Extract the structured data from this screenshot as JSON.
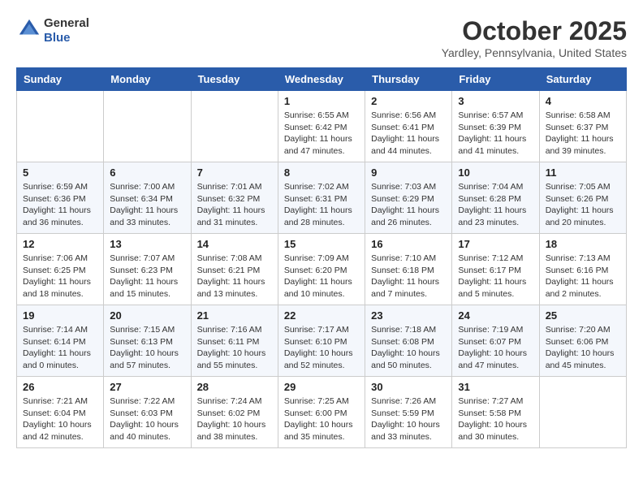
{
  "header": {
    "logo_line1": "General",
    "logo_line2": "Blue",
    "month": "October 2025",
    "location": "Yardley, Pennsylvania, United States"
  },
  "weekdays": [
    "Sunday",
    "Monday",
    "Tuesday",
    "Wednesday",
    "Thursday",
    "Friday",
    "Saturday"
  ],
  "weeks": [
    [
      {
        "day": "",
        "info": ""
      },
      {
        "day": "",
        "info": ""
      },
      {
        "day": "",
        "info": ""
      },
      {
        "day": "1",
        "info": "Sunrise: 6:55 AM\nSunset: 6:42 PM\nDaylight: 11 hours and 47 minutes."
      },
      {
        "day": "2",
        "info": "Sunrise: 6:56 AM\nSunset: 6:41 PM\nDaylight: 11 hours and 44 minutes."
      },
      {
        "day": "3",
        "info": "Sunrise: 6:57 AM\nSunset: 6:39 PM\nDaylight: 11 hours and 41 minutes."
      },
      {
        "day": "4",
        "info": "Sunrise: 6:58 AM\nSunset: 6:37 PM\nDaylight: 11 hours and 39 minutes."
      }
    ],
    [
      {
        "day": "5",
        "info": "Sunrise: 6:59 AM\nSunset: 6:36 PM\nDaylight: 11 hours and 36 minutes."
      },
      {
        "day": "6",
        "info": "Sunrise: 7:00 AM\nSunset: 6:34 PM\nDaylight: 11 hours and 33 minutes."
      },
      {
        "day": "7",
        "info": "Sunrise: 7:01 AM\nSunset: 6:32 PM\nDaylight: 11 hours and 31 minutes."
      },
      {
        "day": "8",
        "info": "Sunrise: 7:02 AM\nSunset: 6:31 PM\nDaylight: 11 hours and 28 minutes."
      },
      {
        "day": "9",
        "info": "Sunrise: 7:03 AM\nSunset: 6:29 PM\nDaylight: 11 hours and 26 minutes."
      },
      {
        "day": "10",
        "info": "Sunrise: 7:04 AM\nSunset: 6:28 PM\nDaylight: 11 hours and 23 minutes."
      },
      {
        "day": "11",
        "info": "Sunrise: 7:05 AM\nSunset: 6:26 PM\nDaylight: 11 hours and 20 minutes."
      }
    ],
    [
      {
        "day": "12",
        "info": "Sunrise: 7:06 AM\nSunset: 6:25 PM\nDaylight: 11 hours and 18 minutes."
      },
      {
        "day": "13",
        "info": "Sunrise: 7:07 AM\nSunset: 6:23 PM\nDaylight: 11 hours and 15 minutes."
      },
      {
        "day": "14",
        "info": "Sunrise: 7:08 AM\nSunset: 6:21 PM\nDaylight: 11 hours and 13 minutes."
      },
      {
        "day": "15",
        "info": "Sunrise: 7:09 AM\nSunset: 6:20 PM\nDaylight: 11 hours and 10 minutes."
      },
      {
        "day": "16",
        "info": "Sunrise: 7:10 AM\nSunset: 6:18 PM\nDaylight: 11 hours and 7 minutes."
      },
      {
        "day": "17",
        "info": "Sunrise: 7:12 AM\nSunset: 6:17 PM\nDaylight: 11 hours and 5 minutes."
      },
      {
        "day": "18",
        "info": "Sunrise: 7:13 AM\nSunset: 6:16 PM\nDaylight: 11 hours and 2 minutes."
      }
    ],
    [
      {
        "day": "19",
        "info": "Sunrise: 7:14 AM\nSunset: 6:14 PM\nDaylight: 11 hours and 0 minutes."
      },
      {
        "day": "20",
        "info": "Sunrise: 7:15 AM\nSunset: 6:13 PM\nDaylight: 10 hours and 57 minutes."
      },
      {
        "day": "21",
        "info": "Sunrise: 7:16 AM\nSunset: 6:11 PM\nDaylight: 10 hours and 55 minutes."
      },
      {
        "day": "22",
        "info": "Sunrise: 7:17 AM\nSunset: 6:10 PM\nDaylight: 10 hours and 52 minutes."
      },
      {
        "day": "23",
        "info": "Sunrise: 7:18 AM\nSunset: 6:08 PM\nDaylight: 10 hours and 50 minutes."
      },
      {
        "day": "24",
        "info": "Sunrise: 7:19 AM\nSunset: 6:07 PM\nDaylight: 10 hours and 47 minutes."
      },
      {
        "day": "25",
        "info": "Sunrise: 7:20 AM\nSunset: 6:06 PM\nDaylight: 10 hours and 45 minutes."
      }
    ],
    [
      {
        "day": "26",
        "info": "Sunrise: 7:21 AM\nSunset: 6:04 PM\nDaylight: 10 hours and 42 minutes."
      },
      {
        "day": "27",
        "info": "Sunrise: 7:22 AM\nSunset: 6:03 PM\nDaylight: 10 hours and 40 minutes."
      },
      {
        "day": "28",
        "info": "Sunrise: 7:24 AM\nSunset: 6:02 PM\nDaylight: 10 hours and 38 minutes."
      },
      {
        "day": "29",
        "info": "Sunrise: 7:25 AM\nSunset: 6:00 PM\nDaylight: 10 hours and 35 minutes."
      },
      {
        "day": "30",
        "info": "Sunrise: 7:26 AM\nSunset: 5:59 PM\nDaylight: 10 hours and 33 minutes."
      },
      {
        "day": "31",
        "info": "Sunrise: 7:27 AM\nSunset: 5:58 PM\nDaylight: 10 hours and 30 minutes."
      },
      {
        "day": "",
        "info": ""
      }
    ]
  ]
}
